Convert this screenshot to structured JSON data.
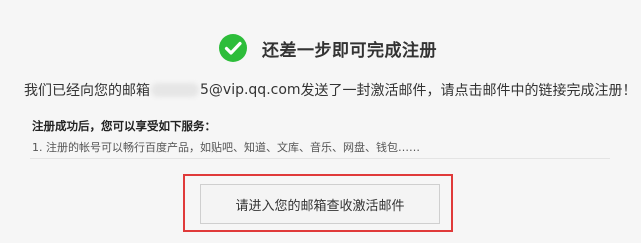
{
  "header": {
    "title": "还差一步即可完成注册",
    "icon": "check-circle-icon",
    "icon_color": "#2dbd3a"
  },
  "message": {
    "before_email": "我们已经向您的邮箱",
    "email_visible_suffix": "5@vip.qq.com",
    "after_email": "发送了一封激活邮件，请点击邮件中的链接完成注册！"
  },
  "services": {
    "title": "注册成功后，您可以享受如下服务：",
    "items": [
      "1. 注册的帐号可以畅行百度产品，如贴吧、知道、文库、音乐、网盘、钱包……"
    ]
  },
  "action": {
    "button_label": "请进入您的邮箱查收激活邮件",
    "highlight_color": "#e03a3a"
  }
}
